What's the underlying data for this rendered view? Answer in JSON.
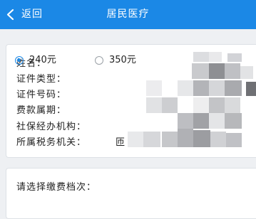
{
  "header": {
    "back_label": "返回",
    "title": "居民医疗",
    "accent_color": "#1b88e6"
  },
  "info": {
    "labels": [
      "姓名：",
      "证件类型：",
      "证件号码：",
      "费款属期：",
      "社保经办机构：",
      "所属税务机关："
    ],
    "tax_office_value_fragment": "匝",
    "row4_mark": "↵"
  },
  "level": {
    "prompt": "请选择缴费档次：",
    "options": [
      {
        "label": "240元",
        "selected": true
      },
      {
        "label": "350元",
        "selected": false
      }
    ]
  }
}
